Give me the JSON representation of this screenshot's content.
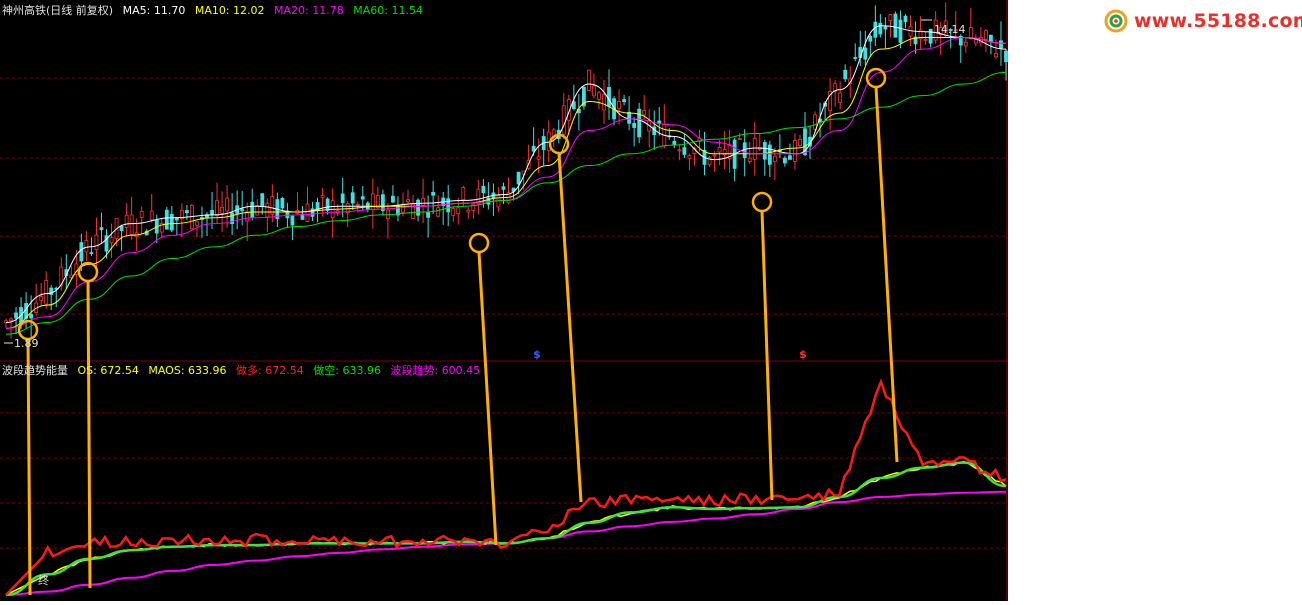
{
  "top_panel": {
    "title": "神州高铁(日线 前复权)",
    "ma5": {
      "label": "MA5:",
      "value": "11.70",
      "color": "#ffffff"
    },
    "ma10": {
      "label": "MA10:",
      "value": "12.02",
      "color": "#ffff00"
    },
    "ma20": {
      "label": "MA20:",
      "value": "11.78",
      "color": "#ff00ff"
    },
    "ma60": {
      "label": "MA60:",
      "value": "11.54",
      "color": "#00e000"
    },
    "high_label": "14.14",
    "low_label": "1.89"
  },
  "bottom_panel": {
    "title": "波段趋势能量",
    "os": {
      "label": "OS:",
      "value": "672.54",
      "color": "#ffff00"
    },
    "maos": {
      "label": "MAOS:",
      "value": "633.96",
      "color": "#ffff00"
    },
    "zuoduo": {
      "label": "做多:",
      "value": "672.54",
      "color": "#ff2020"
    },
    "zuokong": {
      "label": "做空:",
      "value": "633.96",
      "color": "#00e000"
    },
    "trend": {
      "label": "波段趋势:",
      "value": "600.45",
      "color": "#ff00ff"
    },
    "marker_text": "终",
    "signal_symbol": "$"
  },
  "watermark": {
    "text": "www.55188.com"
  },
  "colors": {
    "background": "#000000",
    "up": "#ff3030",
    "down": "#40e0e0",
    "connector": "#ffb000",
    "divider": "#800000"
  },
  "chart_data": [
    {
      "type": "candlestick",
      "title": "神州高铁(日线 前复权)",
      "annotations": [
        "14.14",
        "1.89"
      ],
      "series": [
        {
          "name": "MA5",
          "values": [
            9.3,
            9.8,
            10.6,
            11.0,
            11.1,
            11.15,
            11.3,
            11.2,
            11.3,
            11.3,
            11.35,
            11.4,
            11.5,
            12.4,
            13.4,
            12.8,
            12.5,
            12.1,
            12.3,
            12.2,
            13.3,
            14.4,
            14.3,
            14.2,
            14.0
          ]
        },
        {
          "name": "MA10",
          "values": [
            9.2,
            9.6,
            10.3,
            10.8,
            11.0,
            11.1,
            11.2,
            11.2,
            11.25,
            11.3,
            11.3,
            11.35,
            11.45,
            12.0,
            13.1,
            12.9,
            12.6,
            12.2,
            12.2,
            12.3,
            12.9,
            14.0,
            14.2,
            14.2,
            14.1
          ]
        },
        {
          "name": "MA20",
          "values": [
            9.2,
            9.4,
            10.0,
            10.5,
            10.8,
            11.0,
            11.1,
            11.15,
            11.2,
            11.25,
            11.3,
            11.35,
            11.4,
            11.8,
            12.6,
            12.8,
            12.7,
            12.4,
            12.2,
            12.2,
            12.6,
            13.6,
            14.0,
            14.2,
            14.1
          ]
        },
        {
          "name": "MA60",
          "values": [
            9.1,
            9.3,
            9.7,
            10.1,
            10.4,
            10.6,
            10.8,
            10.95,
            11.05,
            11.15,
            11.2,
            11.3,
            11.4,
            11.7,
            12.0,
            12.2,
            12.35,
            12.45,
            12.55,
            12.65,
            12.8,
            13.0,
            13.2,
            13.4,
            13.6
          ]
        }
      ]
    },
    {
      "type": "line",
      "title": "波段趋势能量",
      "series": [
        {
          "name": "做多",
          "values": [
            0,
            250,
            300,
            310,
            320,
            310,
            320,
            315,
            320,
            310,
            320,
            310,
            300,
            400,
            530,
            560,
            560,
            550,
            560,
            560,
            590,
            1230,
            740,
            770,
            672.54
          ]
        },
        {
          "name": "做空",
          "values": [
            0,
            120,
            210,
            260,
            280,
            290,
            290,
            300,
            300,
            300,
            300,
            310,
            300,
            330,
            420,
            480,
            510,
            500,
            505,
            510,
            570,
            680,
            740,
            770,
            633.96
          ]
        },
        {
          "name": "波段趋势",
          "values": [
            0,
            20,
            60,
            100,
            140,
            175,
            200,
            225,
            245,
            265,
            280,
            295,
            300,
            330,
            370,
            400,
            425,
            445,
            470,
            500,
            540,
            570,
            585,
            595,
            600.45
          ]
        }
      ]
    }
  ]
}
